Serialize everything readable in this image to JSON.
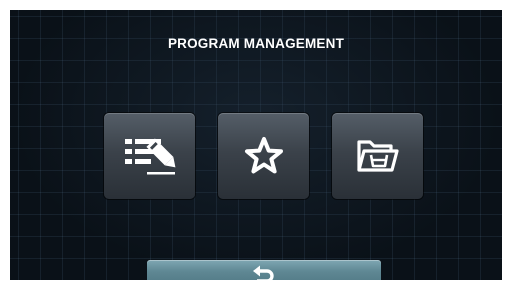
{
  "screen": {
    "title": "PROGRAM MANAGEMENT"
  },
  "tiles": [
    {
      "id": "edit",
      "icon": "edit-list-icon"
    },
    {
      "id": "favorites",
      "icon": "star-icon"
    },
    {
      "id": "library",
      "icon": "folder-basin-icon"
    }
  ],
  "footer": {
    "back_icon": "back-arrow-icon"
  },
  "colors": {
    "background": "#0a1118",
    "tile": "#3b424a",
    "back_button": "#5f8894",
    "icon": "#ffffff"
  }
}
